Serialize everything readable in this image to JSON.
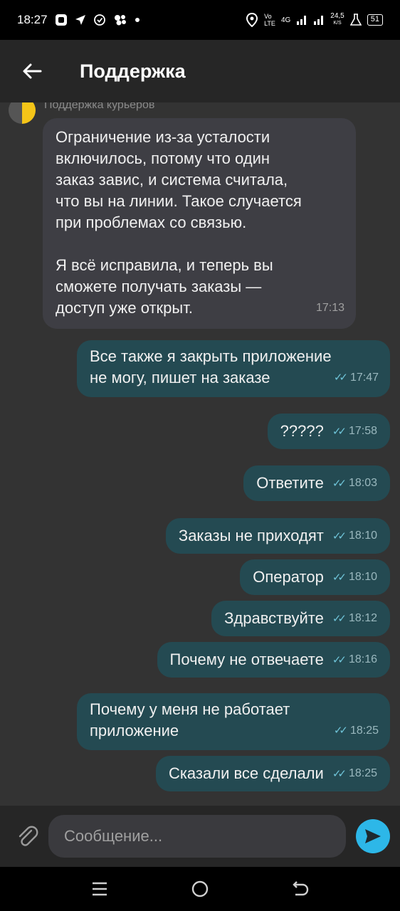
{
  "status_bar": {
    "time": "18:27",
    "network_speed": "24,5",
    "network_speed_unit": "K/S",
    "battery": "51",
    "volte": "Vo",
    "lte": "LTE",
    "g4": "4G"
  },
  "header": {
    "title": "Поддержка"
  },
  "sender": {
    "name": "Поддержка курьеров"
  },
  "incoming": {
    "paragraph1": [
      "Ограничение из-за усталости",
      "включилось, потому что один",
      "заказ завис, и система считала,",
      "что вы на линии. Такое случается",
      "при проблемах со связью."
    ],
    "paragraph2": [
      "Я всё исправила, и теперь вы",
      "сможете получать заказы —",
      "доступ уже открыт."
    ],
    "time": "17:13"
  },
  "outgoing": [
    {
      "lines": [
        "Все также я закрыть приложение",
        "не могу, пишет на заказе"
      ],
      "time": "17:47"
    },
    {
      "text": "?????",
      "time": "17:58"
    },
    {
      "text": "Ответите",
      "time": "18:03"
    },
    {
      "text": "Заказы не приходят",
      "time": "18:10"
    },
    {
      "text": "Оператор",
      "time": "18:10"
    },
    {
      "text": "Здравствуйте",
      "time": "18:12"
    },
    {
      "text": "Почему не отвечаете",
      "time": "18:16"
    },
    {
      "lines": [
        "Почему у меня не работает",
        "приложение"
      ],
      "time": "18:25"
    },
    {
      "text": "Сказали все сделали",
      "time": "18:25"
    }
  ],
  "composer": {
    "placeholder": "Сообщение..."
  },
  "colors": {
    "outgoing_bubble": "#244a52",
    "incoming_bubble": "#3e3e44",
    "send_button": "#2db7e8",
    "read_ticks": "#6fc4d8"
  }
}
